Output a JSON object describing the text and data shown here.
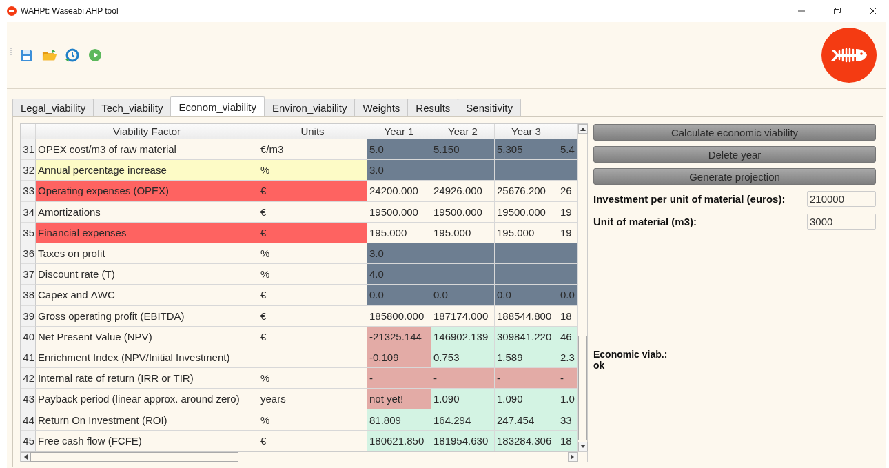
{
  "window": {
    "title": "WAHPt: Waseabi AHP tool"
  },
  "toolbar": {
    "buttons": [
      {
        "kind": "save"
      },
      {
        "kind": "open"
      },
      {
        "kind": "refresh"
      },
      {
        "kind": "run"
      }
    ]
  },
  "tabs": [
    {
      "label": "Legal_viability",
      "selected": false
    },
    {
      "label": "Tech_viability",
      "selected": false
    },
    {
      "label": "Econom_viability",
      "selected": true
    },
    {
      "label": "Environ_viability",
      "selected": false
    },
    {
      "label": "Weights",
      "selected": false
    },
    {
      "label": "Results",
      "selected": false
    },
    {
      "label": "Sensitivity",
      "selected": false
    }
  ],
  "table": {
    "columns": [
      "Viability Factor",
      "Units",
      "Year 1",
      "Year 2",
      "Year 3"
    ],
    "rows": [
      {
        "number": "31",
        "factor": "OPEX cost/m3 of raw material",
        "color": "#fdf8ee",
        "units": "€/m3",
        "cells": [
          {
            "text": "5.0",
            "color": "#6d7e91"
          },
          {
            "text": "5.150",
            "color": "#6d7e91"
          },
          {
            "text": "5.305",
            "color": "#6d7e91"
          },
          {
            "text": "5.4",
            "color": "#6d7e91"
          }
        ]
      },
      {
        "number": "32",
        "factor": "Annual percentage increase",
        "color": "#fdfbc6",
        "units": "%",
        "cells": [
          {
            "text": "3.0",
            "color": "#6d7e91"
          },
          {
            "color": "#6d7e91"
          },
          {
            "color": "#6d7e91"
          },
          {
            "color": "#6d7e91"
          }
        ]
      },
      {
        "number": "33",
        "factor": "Operating expenses (OPEX)",
        "color": "#fe6361",
        "units": "€",
        "cells": [
          {
            "text": "24200.000",
            "color": "#fdf8ee"
          },
          {
            "text": "24926.000",
            "color": "#fdf8ee"
          },
          {
            "text": "25676.200",
            "color": "#fdf8ee"
          },
          {
            "text": "26",
            "color": "#fdf8ee"
          }
        ]
      },
      {
        "number": "34",
        "factor": "Amortizations",
        "color": "#fdf8ee",
        "units": "€",
        "cells": [
          {
            "text": "19500.000",
            "color": "#fdf8ee"
          },
          {
            "text": "19500.000",
            "color": "#fdf8ee"
          },
          {
            "text": "19500.000",
            "color": "#fdf8ee"
          },
          {
            "text": "19",
            "color": "#fdf8ee"
          }
        ]
      },
      {
        "number": "35",
        "factor": "Financial expenses",
        "color": "#fe6361",
        "units": "€",
        "cells": [
          {
            "text": "195.000",
            "color": "#fdf8ee"
          },
          {
            "text": "195.000",
            "color": "#fdf8ee"
          },
          {
            "text": "195.000",
            "color": "#fdf8ee"
          },
          {
            "text": "19",
            "color": "#fdf8ee"
          }
        ]
      },
      {
        "number": "36",
        "factor": "Taxes on profit",
        "color": "#fdf8ee",
        "units": "%",
        "cells": [
          {
            "text": "3.0",
            "color": "#6d7e91"
          },
          {
            "color": "#6d7e91"
          },
          {
            "color": "#6d7e91"
          },
          {
            "color": "#6d7e91"
          }
        ]
      },
      {
        "number": "37",
        "factor": "Discount rate (T)",
        "color": "#fdf8ee",
        "units": "%",
        "cells": [
          {
            "text": "4.0",
            "color": "#6d7e91"
          },
          {
            "color": "#6d7e91"
          },
          {
            "color": "#6d7e91"
          },
          {
            "color": "#6d7e91"
          }
        ]
      },
      {
        "number": "38",
        "factor": "Capex and ΔWC",
        "color": "#fdf8ee",
        "units": "€",
        "cells": [
          {
            "text": "0.0",
            "color": "#6d7e91"
          },
          {
            "text": "0.0",
            "color": "#6d7e91"
          },
          {
            "text": "0.0",
            "color": "#6d7e91"
          },
          {
            "text": "0.0",
            "color": "#6d7e91"
          }
        ]
      },
      {
        "number": "39",
        "factor": "Gross operating profit (EBITDA)",
        "color": "#fdf8ee",
        "units": "€",
        "cells": [
          {
            "text": "185800.000",
            "color": "#fdf8ee"
          },
          {
            "text": "187174.000",
            "color": "#fdf8ee"
          },
          {
            "text": "188544.800",
            "color": "#fdf8ee"
          },
          {
            "text": "18",
            "color": "#fdf8ee"
          }
        ]
      },
      {
        "number": "40",
        "factor": "Net Present Value (NPV)",
        "color": "#fdf8ee",
        "units": "€",
        "cells": [
          {
            "text": "-21325.144",
            "color": "#e3aba6"
          },
          {
            "text": "146902.139",
            "color": "#d3f3e3"
          },
          {
            "text": "309841.220",
            "color": "#d3f3e3"
          },
          {
            "text": "46",
            "color": "#d3f3e3"
          }
        ]
      },
      {
        "number": "41",
        "factor": "Enrichment Index (NPV/Initial Investment)",
        "color": "#fdf8ee",
        "cells": [
          {
            "text": "-0.109",
            "color": "#e3aba6"
          },
          {
            "text": "0.753",
            "color": "#d3f3e3"
          },
          {
            "text": "1.589",
            "color": "#d3f3e3"
          },
          {
            "text": "2.3",
            "color": "#d3f3e3"
          }
        ]
      },
      {
        "number": "42",
        "factor": "Internal rate of return (IRR or TIR)",
        "color": "#fdf8ee",
        "units": "%",
        "cells": [
          {
            "text": "-",
            "color": "#e3aba6"
          },
          {
            "text": "-",
            "color": "#e3aba6"
          },
          {
            "text": "-",
            "color": "#e3aba6"
          },
          {
            "text": "-",
            "color": "#e3aba6"
          }
        ]
      },
      {
        "number": "43",
        "factor": "Payback period (linear approx. around zero)",
        "color": "#fdf8ee",
        "units": "years",
        "cells": [
          {
            "text": "not yet!",
            "color": "#e3aba6"
          },
          {
            "text": "1.090",
            "color": "#d3f3e3"
          },
          {
            "text": "1.090",
            "color": "#d3f3e3"
          },
          {
            "text": "1.0",
            "color": "#d3f3e3"
          }
        ]
      },
      {
        "number": "44",
        "factor": "Return On Investment (ROI)",
        "color": "#fdf8ee",
        "units": "%",
        "cells": [
          {
            "text": "81.809",
            "color": "#d3f3e3"
          },
          {
            "text": "164.294",
            "color": "#d3f3e3"
          },
          {
            "text": "247.454",
            "color": "#d3f3e3"
          },
          {
            "text": "33",
            "color": "#d3f3e3"
          }
        ]
      },
      {
        "number": "45",
        "factor": "Free cash flow (FCFE)",
        "color": "#fdf8ee",
        "units": "€",
        "cells": [
          {
            "text": "180621.850",
            "color": "#d3f3e3"
          },
          {
            "text": "181954.630",
            "color": "#d3f3e3"
          },
          {
            "text": "183284.306",
            "color": "#d3f3e3"
          },
          {
            "text": "18",
            "color": "#d3f3e3"
          }
        ]
      }
    ]
  },
  "actions": [
    "Calculate economic viability",
    "Delete year",
    "Generate projection"
  ],
  "fields": [
    {
      "label": "Investment per unit of material (euros):",
      "value": "210000"
    },
    {
      "label": "Unit of material (m3):",
      "value": "3000"
    }
  ],
  "result": {
    "label": "Economic viab.:",
    "value": "ok"
  }
}
